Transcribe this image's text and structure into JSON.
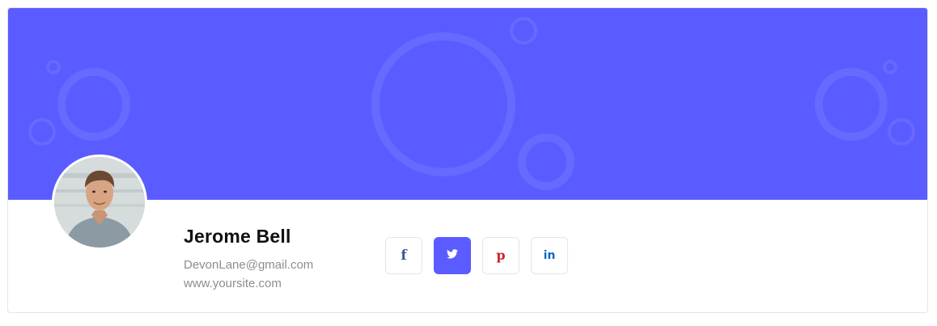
{
  "profile": {
    "name": "Jerome Bell",
    "email": "DevonLane@gmail.com",
    "website": "www.yoursite.com"
  },
  "socials": [
    {
      "network": "facebook",
      "icon": "facebook-icon",
      "glyph": "f",
      "color": "#3b5998",
      "active": false
    },
    {
      "network": "twitter",
      "icon": "twitter-icon",
      "glyph": "",
      "color": "#ffffff",
      "active": true
    },
    {
      "network": "pinterest",
      "icon": "pinterest-icon",
      "glyph": "p",
      "color": "#c8232c",
      "active": false
    },
    {
      "network": "linkedin",
      "icon": "linkedin-icon",
      "glyph": "in",
      "color": "#0a66c2",
      "active": false
    }
  ],
  "theme": {
    "accent": "#5b5cff",
    "cover_ring": "#6a6cff"
  }
}
